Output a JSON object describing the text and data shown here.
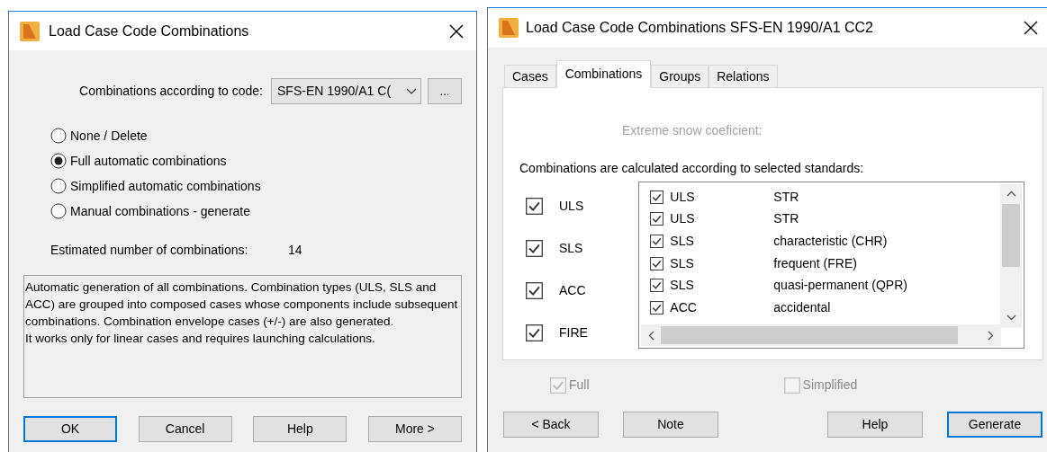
{
  "left_dialog": {
    "title": "Load Case Code Combinations",
    "code_label": "Combinations according to code:",
    "code_value": "SFS-EN 1990/A1 C(",
    "browse_button": "...",
    "options": [
      {
        "label": "None / Delete",
        "selected": false
      },
      {
        "label": "Full automatic combinations",
        "selected": true
      },
      {
        "label": "Simplified automatic combinations",
        "selected": false
      },
      {
        "label": "Manual combinations - generate",
        "selected": false
      }
    ],
    "estimate_label": "Estimated number of combinations:",
    "estimate_value": "14",
    "description": "Automatic generation of all combinations. Combination types (ULS, SLS and ACC) are grouped into composed cases whose components include subsequent combinations. Combination envelope cases (+/-) are also generated.\nIt works only for linear cases and requires launching calculations.",
    "buttons": [
      {
        "label": "OK",
        "default": true
      },
      {
        "label": "Cancel",
        "default": false
      },
      {
        "label": "Help",
        "default": false
      },
      {
        "label": "More >",
        "default": false
      }
    ]
  },
  "right_dialog": {
    "title": "Load Case Code Combinations SFS-EN 1990/A1 CC2",
    "tabs": [
      {
        "label": "Cases",
        "selected": false
      },
      {
        "label": "Combinations",
        "selected": true
      },
      {
        "label": "Groups",
        "selected": false
      },
      {
        "label": "Relations",
        "selected": false
      }
    ],
    "snow_label": "Extreme snow coeficient:",
    "standards_label": "Combinations are calculated according to selected standards:",
    "standards": [
      {
        "label": "ULS",
        "checked": true
      },
      {
        "label": "SLS",
        "checked": true
      },
      {
        "label": "ACC",
        "checked": true
      },
      {
        "label": "FIRE",
        "checked": true
      }
    ],
    "combination_rows": [
      {
        "checked": true,
        "type": "ULS",
        "name": "STR"
      },
      {
        "checked": true,
        "type": "ULS",
        "name": "STR"
      },
      {
        "checked": true,
        "type": "SLS",
        "name": "characteristic (CHR)"
      },
      {
        "checked": true,
        "type": "SLS",
        "name": "frequent (FRE)"
      },
      {
        "checked": true,
        "type": "SLS",
        "name": "quasi-permanent (QPR)"
      },
      {
        "checked": true,
        "type": "ACC",
        "name": "accidental"
      }
    ],
    "options": [
      {
        "label": "Full",
        "checked": true,
        "disabled": true
      },
      {
        "label": "Simplified",
        "checked": false,
        "disabled": true
      }
    ],
    "buttons": [
      {
        "label": "< Back",
        "default": false
      },
      {
        "label": "Note",
        "default": false
      },
      {
        "label": "Help",
        "default": false
      },
      {
        "label": "Generate",
        "default": true
      }
    ]
  }
}
